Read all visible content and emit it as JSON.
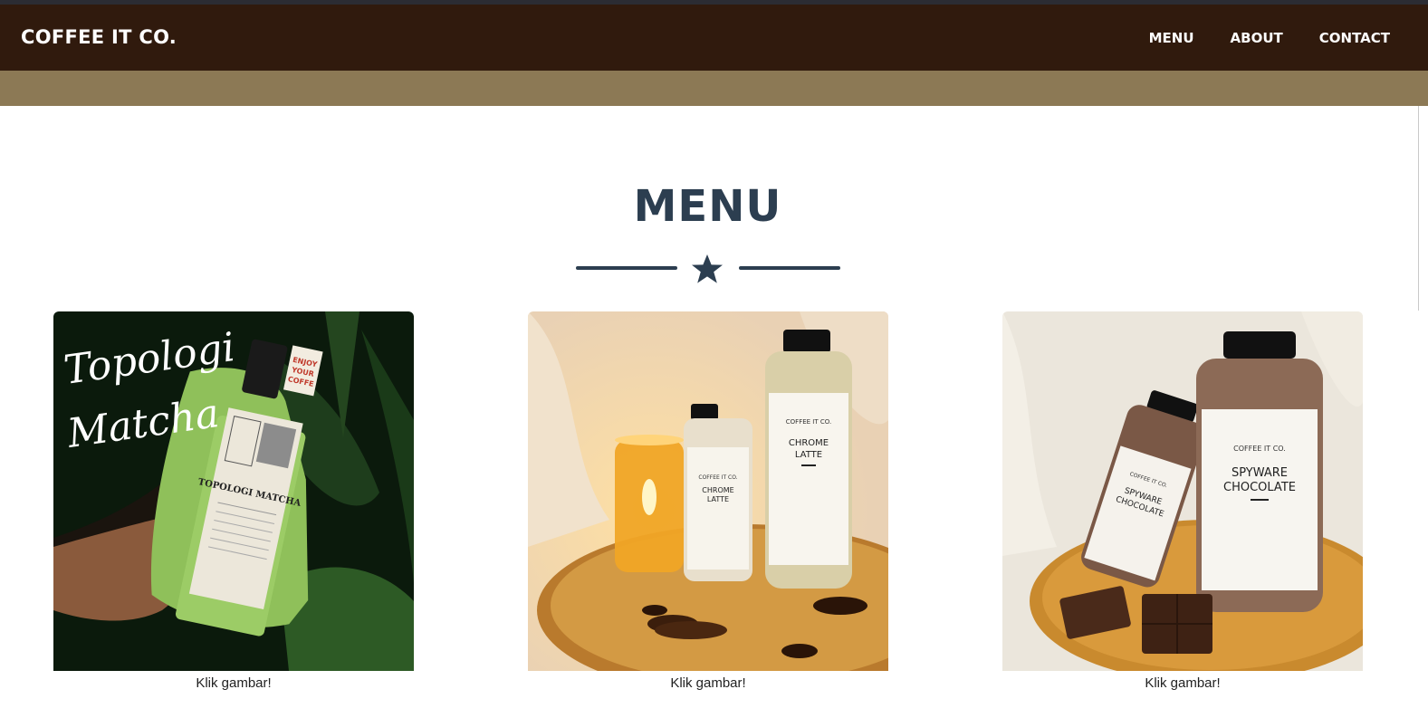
{
  "navbar": {
    "brand": "COFFEE IT CO.",
    "links": [
      {
        "label": "MENU"
      },
      {
        "label": "ABOUT"
      },
      {
        "label": "CONTACT"
      }
    ]
  },
  "section": {
    "title": "MENU",
    "divider_icon": "star-icon"
  },
  "menu_items": [
    {
      "photo_overlay_text": "Topologi Matcha",
      "bottle_cap_label": "ENJOY YOUR COFFE",
      "bottle_label": "TOPOLOGI MATCHA",
      "caption": "Klik gambar!"
    },
    {
      "bottle_label_brand": "COFFEE IT CO.",
      "bottle_label": "CHROME LATTE",
      "caption": "Klik gambar!"
    },
    {
      "bottle_label_brand": "COFFEE IT CO.",
      "bottle_label": "SPYWARE CHOCOLATE",
      "caption": "Klik gambar!"
    }
  ],
  "colors": {
    "navbar_bg": "#301a0d",
    "band_bg": "#8c7955",
    "heading": "#2c3e50"
  }
}
